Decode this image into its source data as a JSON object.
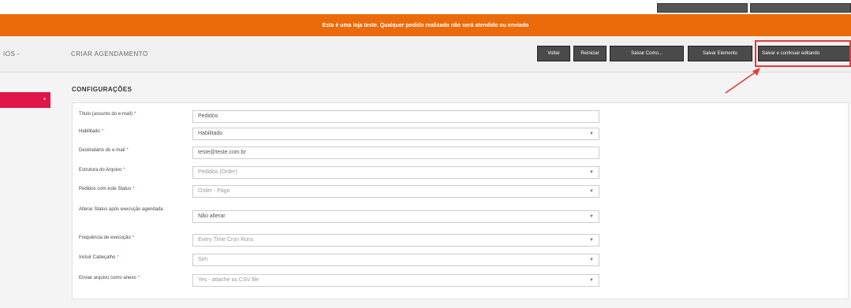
{
  "notice": "Esta é uma loja teste. Qualquer pedido realizado não será atendido ou enviado",
  "nav_label": "IOS -",
  "page_title": "CRIAR AGENDAMENTO",
  "buttons": {
    "voltar": "Voltar",
    "reiniciar": "Reiniciar",
    "salvar_como": "Salvar Como...",
    "salvar_elemento": "Salvar Elemento",
    "salvar_continuar": "Salvar e continuar editando"
  },
  "sidebar_active_icon": "▪",
  "section_title": "CONFIGURAÇÕES",
  "form": {
    "titulo": {
      "label": "Título (assunto do e-mail)",
      "value": "Pedidos"
    },
    "habilitado": {
      "label": "Habilitado",
      "value": "Habilitado"
    },
    "destinatario": {
      "label": "Destinatário do e-mail",
      "value": "teste@teste.com.br"
    },
    "estrutura": {
      "label": "Estrutura do Arquivo",
      "value": "Pedidos (Order)"
    },
    "status": {
      "label": "Pedidos com este Status",
      "value": "Order - Pago"
    },
    "alterar": {
      "label": "Alterar Status após execução agendada",
      "value": "Não alterar"
    },
    "frequencia": {
      "label": "Frequência de execução",
      "value": "Every Time Cron Runs"
    },
    "cabecalho": {
      "label": "Incluir Cabeçalho",
      "value": "Sim"
    },
    "anexo": {
      "label": "Enviar arquivo como anexo",
      "value": "Yes - attache as CSV file"
    }
  },
  "colors": {
    "notice_bg": "#eb6b0a",
    "accent": "#e0164a",
    "highlight": "#e53935"
  }
}
